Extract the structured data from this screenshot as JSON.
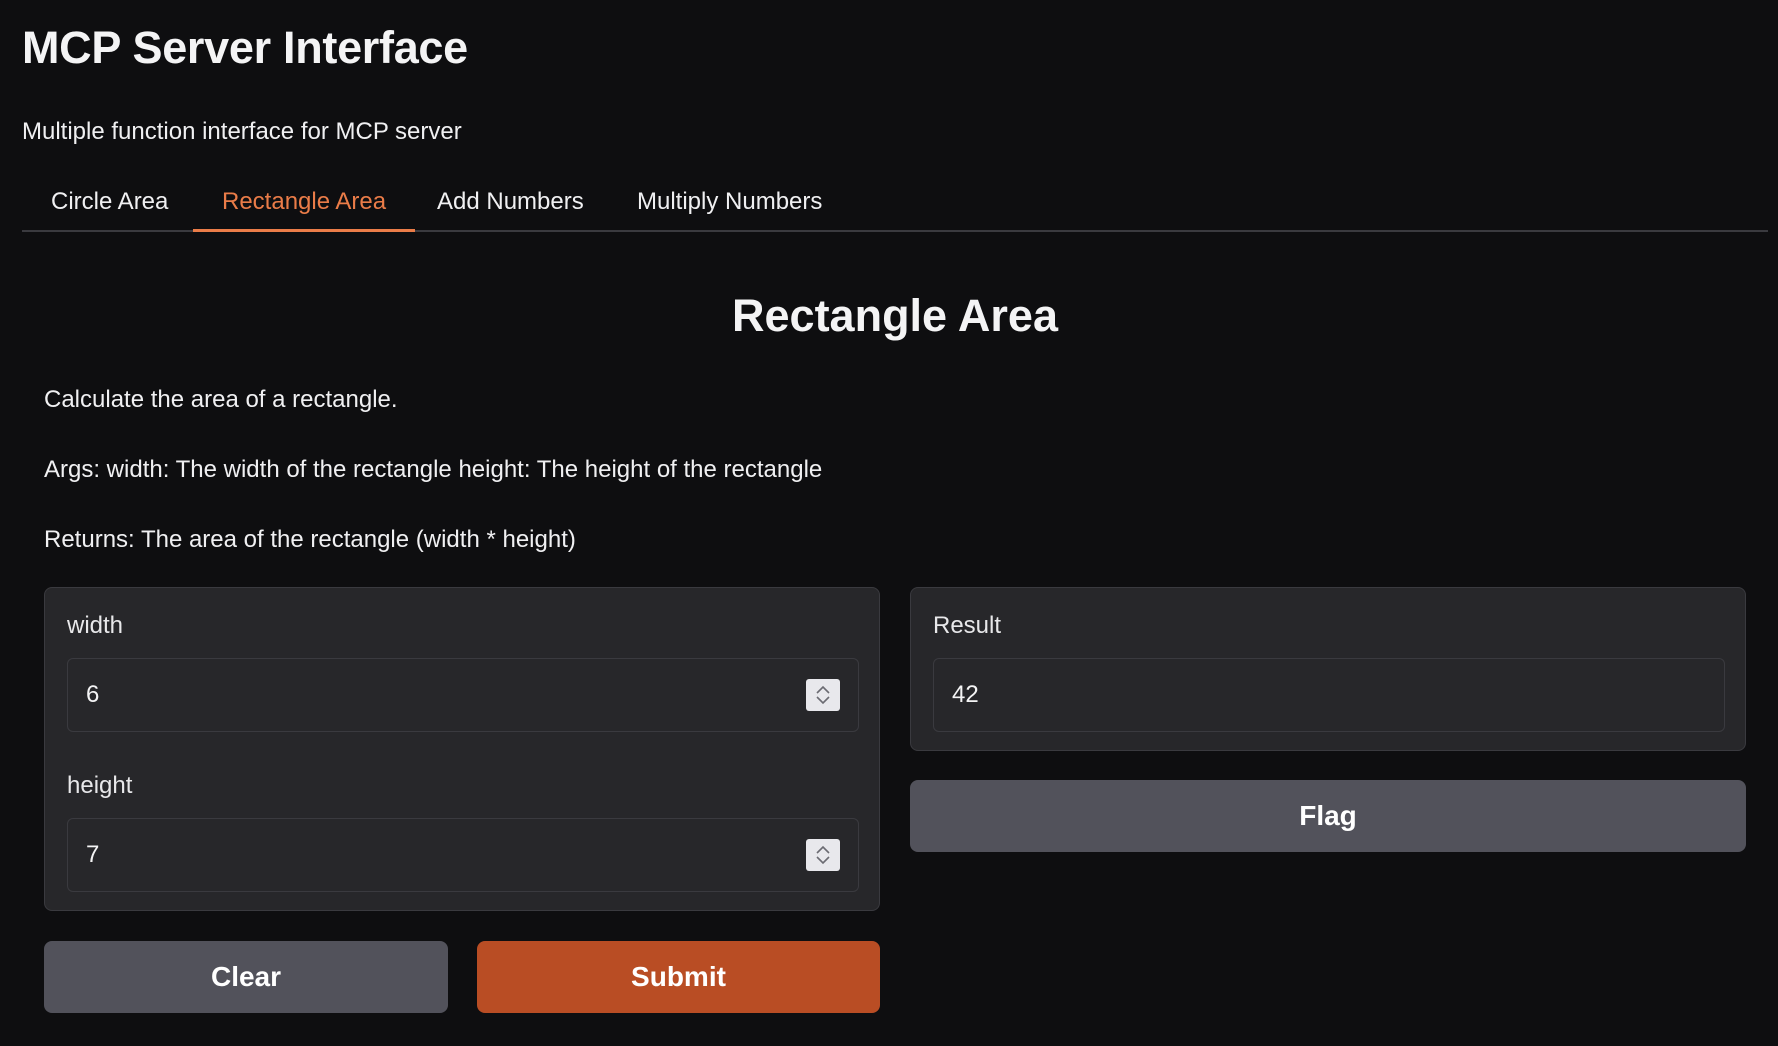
{
  "header": {
    "title": "MCP Server Interface",
    "subtitle": "Multiple function interface for MCP server"
  },
  "tabs": [
    {
      "label": "Circle Area",
      "active": false
    },
    {
      "label": "Rectangle Area",
      "active": true
    },
    {
      "label": "Add Numbers",
      "active": false
    },
    {
      "label": "Multiply Numbers",
      "active": false
    }
  ],
  "function": {
    "title": "Rectangle Area",
    "description": "Calculate the area of a rectangle.",
    "args": "Args: width: The width of the rectangle height: The height of the rectangle",
    "returns": "Returns: The area of the rectangle (width * height)"
  },
  "inputs": {
    "width": {
      "label": "width",
      "value": "6"
    },
    "height": {
      "label": "height",
      "value": "7"
    }
  },
  "output": {
    "label": "Result",
    "value": "42"
  },
  "buttons": {
    "clear": "Clear",
    "submit": "Submit",
    "flag": "Flag"
  },
  "colors": {
    "accent": "#ea7c48",
    "primary_button": "#b94d24",
    "secondary_button": "#52525b",
    "background": "#0e0e10",
    "panel": "#27272a"
  },
  "icons": {
    "number_spinner": "up-down-chevron-icon"
  }
}
